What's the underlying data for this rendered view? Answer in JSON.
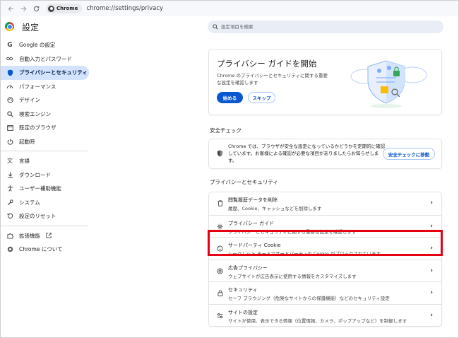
{
  "browser": {
    "chip_label": "Chrome",
    "url": "chrome://settings/privacy"
  },
  "header": {
    "title": "設定",
    "search_placeholder": "設定項目を検索"
  },
  "sidebar": {
    "items": [
      {
        "label": "Google の設定",
        "icon": "google-g-icon"
      },
      {
        "label": "自動入力とパスワード",
        "icon": "key-icon"
      },
      {
        "label": "プライバシーとセキュリティ",
        "icon": "shield-icon",
        "active": true
      },
      {
        "label": "パフォーマンス",
        "icon": "speedometer-icon"
      },
      {
        "label": "デザイン",
        "icon": "palette-icon"
      },
      {
        "label": "検索エンジン",
        "icon": "search-icon"
      },
      {
        "label": "既定のブラウザ",
        "icon": "browser-window-icon"
      },
      {
        "label": "起動時",
        "icon": "power-icon"
      },
      {
        "label": "言語",
        "icon": "translate-icon"
      },
      {
        "label": "ダウンロード",
        "icon": "download-icon"
      },
      {
        "label": "ユーザー補助機能",
        "icon": "accessibility-icon"
      },
      {
        "label": "システム",
        "icon": "wrench-icon"
      },
      {
        "label": "設定のリセット",
        "icon": "reset-icon"
      },
      {
        "label": "拡張機能",
        "icon": "puzzle-icon"
      },
      {
        "label": "Chrome について",
        "icon": "chrome-logo-icon"
      }
    ]
  },
  "guide": {
    "title": "プライバシー ガイドを開始",
    "description": "Chrome のプライバシーとセキュリティに関する重要な設定を確認します",
    "start_label": "始める",
    "skip_label": "スキップ"
  },
  "safety_check": {
    "section_title": "安全チェック",
    "text": "Chrome では、ブラウザが安全な設定になっているかどうかを定期的に確認しています。お客様による確認が必要な項目がありましたらお知らせします。",
    "button_label": "安全チェックに移動"
  },
  "privacy": {
    "section_title": "プライバシーとセキュリティ",
    "rows": [
      {
        "title": "閲覧履歴データを削除",
        "desc": "履歴、Cookie、キャッシュなどを削除します",
        "icon": "trash-icon"
      },
      {
        "title": "プライバシー ガイド",
        "desc": "プライバシーとセキュリティに関する重要な設定を確認します",
        "icon": "privacy-guide-icon"
      },
      {
        "title": "サードパーティ Cookie",
        "desc": "シークレット モードでサードパーティの Cookie がブロックされています",
        "icon": "cookie-icon"
      },
      {
        "title": "広告プライバシー",
        "desc": "ウェブサイトが広告表示に使用する情報をカスタマイズします",
        "icon": "ad-privacy-icon"
      },
      {
        "title": "セキュリティ",
        "desc": "セーフ ブラウジング（危険なサイトからの保護機能）などのセキュリティ設定",
        "icon": "lock-icon"
      },
      {
        "title": "サイトの設定",
        "desc": "サイトが使用、表示できる情報（位置情報、カメラ、ポップアップなど）を制御します",
        "icon": "sliders-icon"
      }
    ]
  },
  "colors": {
    "accent": "#0b57d0",
    "active_nav": "#d3e3fd",
    "highlight_box": "#e60012"
  }
}
